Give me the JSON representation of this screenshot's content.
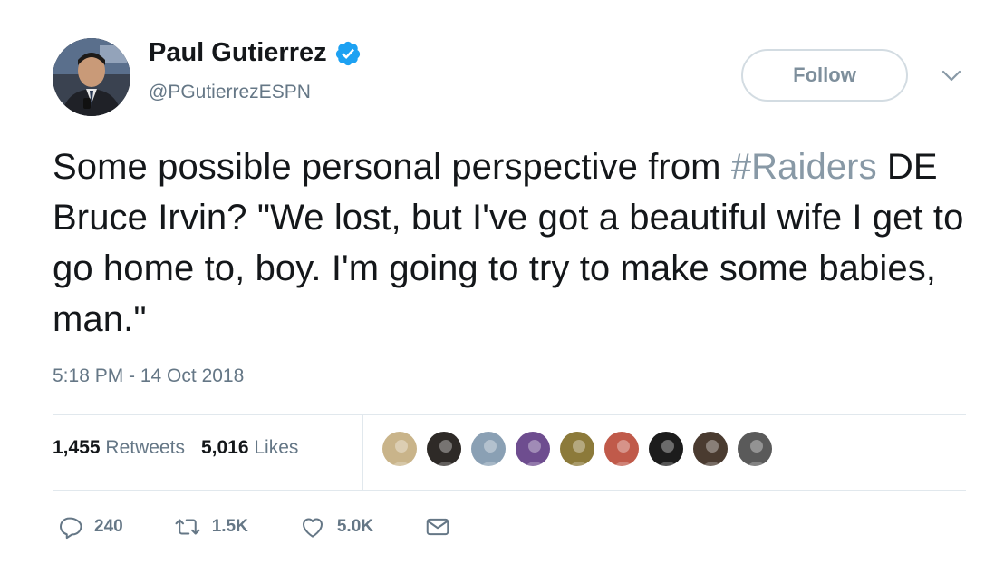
{
  "author": {
    "display_name": "Paul Gutierrez",
    "handle": "@PGutierrezESPN",
    "verified": true,
    "avatar_icon": "reporter-photo"
  },
  "follow_button": {
    "label": "Follow"
  },
  "menu_icon": "chevron-down-icon",
  "tweet": {
    "text_before_hashtag": "Some possible personal perspective from ",
    "hashtag": "#Raiders",
    "text_after_hashtag": " DE Bruce Irvin? \"We lost, but I've got a beautiful wife I get to go home to, boy. I'm going to try to make some babies, man.\"",
    "timestamp": "5:18 PM - 14 Oct 2018"
  },
  "stats": {
    "retweets_count": "1,455",
    "retweets_label": "Retweets",
    "likes_count": "5,016",
    "likes_label": "Likes"
  },
  "likers": [
    {
      "icon": "liker-avatar-1",
      "color": "#c9b48a"
    },
    {
      "icon": "liker-avatar-2",
      "color": "#2e2a27"
    },
    {
      "icon": "liker-avatar-3",
      "color": "#8aa0b4"
    },
    {
      "icon": "liker-avatar-4",
      "color": "#6e4d8f"
    },
    {
      "icon": "liker-avatar-5",
      "color": "#8c7a3a"
    },
    {
      "icon": "liker-avatar-6",
      "color": "#c05a4a"
    },
    {
      "icon": "liker-avatar-7",
      "color": "#1c1c1c"
    },
    {
      "icon": "liker-avatar-8",
      "color": "#4a3b30"
    },
    {
      "icon": "liker-avatar-9",
      "color": "#5a5a5a"
    }
  ],
  "actions": {
    "reply_count": "240",
    "retweet_count": "1.5K",
    "like_count": "5.0K"
  },
  "colors": {
    "verified_blue": "#1da1f2",
    "hashtag": "#8899a6",
    "secondary_text": "#657786",
    "divider": "#e1e8ed"
  }
}
